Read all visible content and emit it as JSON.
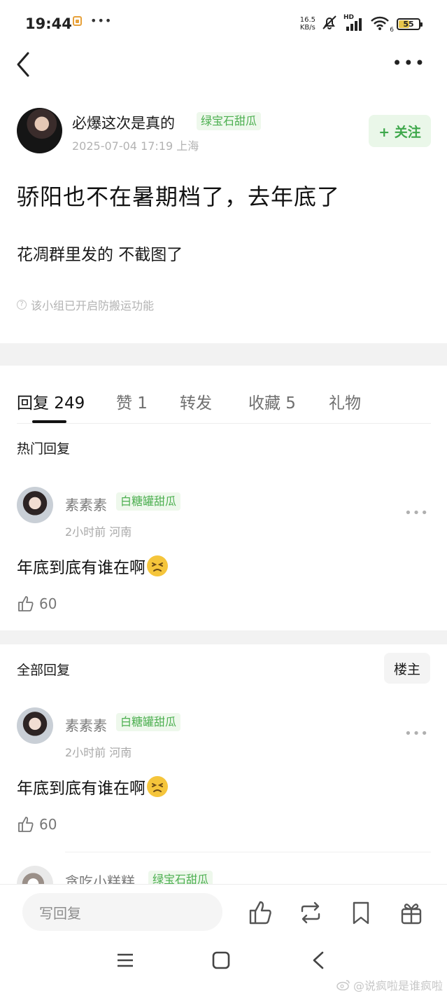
{
  "status_bar": {
    "time": "19:44",
    "net_speed_value": "16.5",
    "net_speed_unit": "KB/s",
    "hd_label": "HD",
    "wifi_sub": "6",
    "battery_level": "55",
    "battery_color": "#e8c64a"
  },
  "post": {
    "author_name": "必爆这次是真的",
    "author_tag": "绿宝石甜瓜",
    "meta": "2025-07-04 17:19  上海",
    "follow_label": "+ 关注",
    "title": "骄阳也不在暑期档了，去年底了",
    "body": "花凋群里发的 不截图了",
    "notice": "该小组已开启防搬运功能"
  },
  "tabs": [
    {
      "label": "回复 249"
    },
    {
      "label": "赞 1"
    },
    {
      "label": "转发"
    },
    {
      "label": "收藏 5"
    },
    {
      "label": "礼物"
    }
  ],
  "hot_replies": {
    "title": "热门回复",
    "items": [
      {
        "name": "素素素",
        "tag": "白糖罐甜瓜",
        "meta": "2小时前  河南",
        "text": "年底到底有谁在啊",
        "likes": "60"
      }
    ]
  },
  "all_replies": {
    "title": "全部回复",
    "floor_host_label": "楼主",
    "items": [
      {
        "name": "素素素",
        "tag": "白糖罐甜瓜",
        "meta": "2小时前  河南",
        "text": "年底到底有谁在啊",
        "likes": "60"
      }
    ],
    "partial": {
      "name": "贪吃小糕糕",
      "tag": "绿宝石甜瓜"
    }
  },
  "bottom_bar": {
    "reply_placeholder": "写回复"
  },
  "watermark": "@说疯啦是谁疯啦",
  "colors": {
    "accent_green": "#4caf50",
    "tag_bg": "#eef8ec",
    "divider": "#f2f2f2"
  }
}
